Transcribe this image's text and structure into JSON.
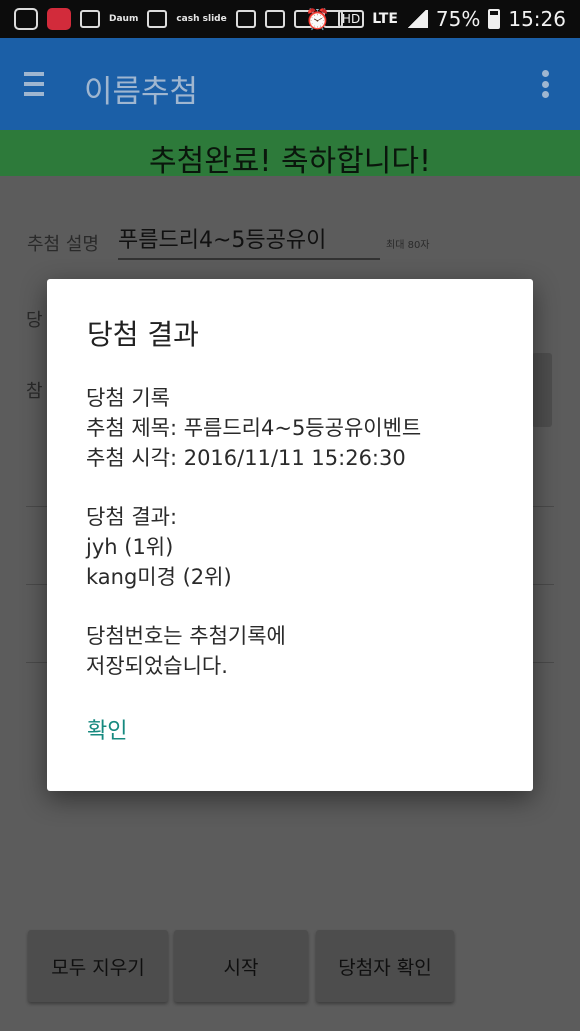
{
  "status_bar": {
    "left_icons": [
      "message-icon",
      "coocha-app-icon",
      "pill-icon",
      "daum-icon",
      "gallery-icon",
      "cash-slide-icon",
      "instagram-icon",
      "instagram-icon",
      "w-app-icon",
      "cash-slide-2-icon"
    ],
    "daum_text": "Daum",
    "cash_text": "cash slide",
    "hd": "HD",
    "lte": "LTE",
    "battery": "75%",
    "time": "15:26"
  },
  "app_bar": {
    "title": "이름추첨"
  },
  "main": {
    "banner": "추첨완료! 축하합니다!",
    "desc_label": "추첨 설명",
    "desc_value": "푸름드리4~5등공유이",
    "desc_hint": "최대 80자",
    "peek_label_1": "당",
    "peek_label_2": "참"
  },
  "bottom_buttons": {
    "clear": "모두 지우기",
    "start": "시작",
    "check": "당첨자 확인"
  },
  "dialog": {
    "title": "당첨 결과",
    "lines": [
      "당첨 기록",
      "추첨 제목: 푸름드리4~5등공유이벤트",
      "추첨 시각: 2016/11/11 15:26:30",
      "",
      "당첨 결과:",
      "jyh (1위)",
      "kang미경 (2위)",
      "",
      "당첨번호는 추첨기록에",
      "저장되었습니다."
    ],
    "ok": "확인"
  },
  "colors": {
    "app_bar": "#1b5fa7",
    "banner": "#2d7a3a",
    "dialog_action": "#16897f"
  }
}
